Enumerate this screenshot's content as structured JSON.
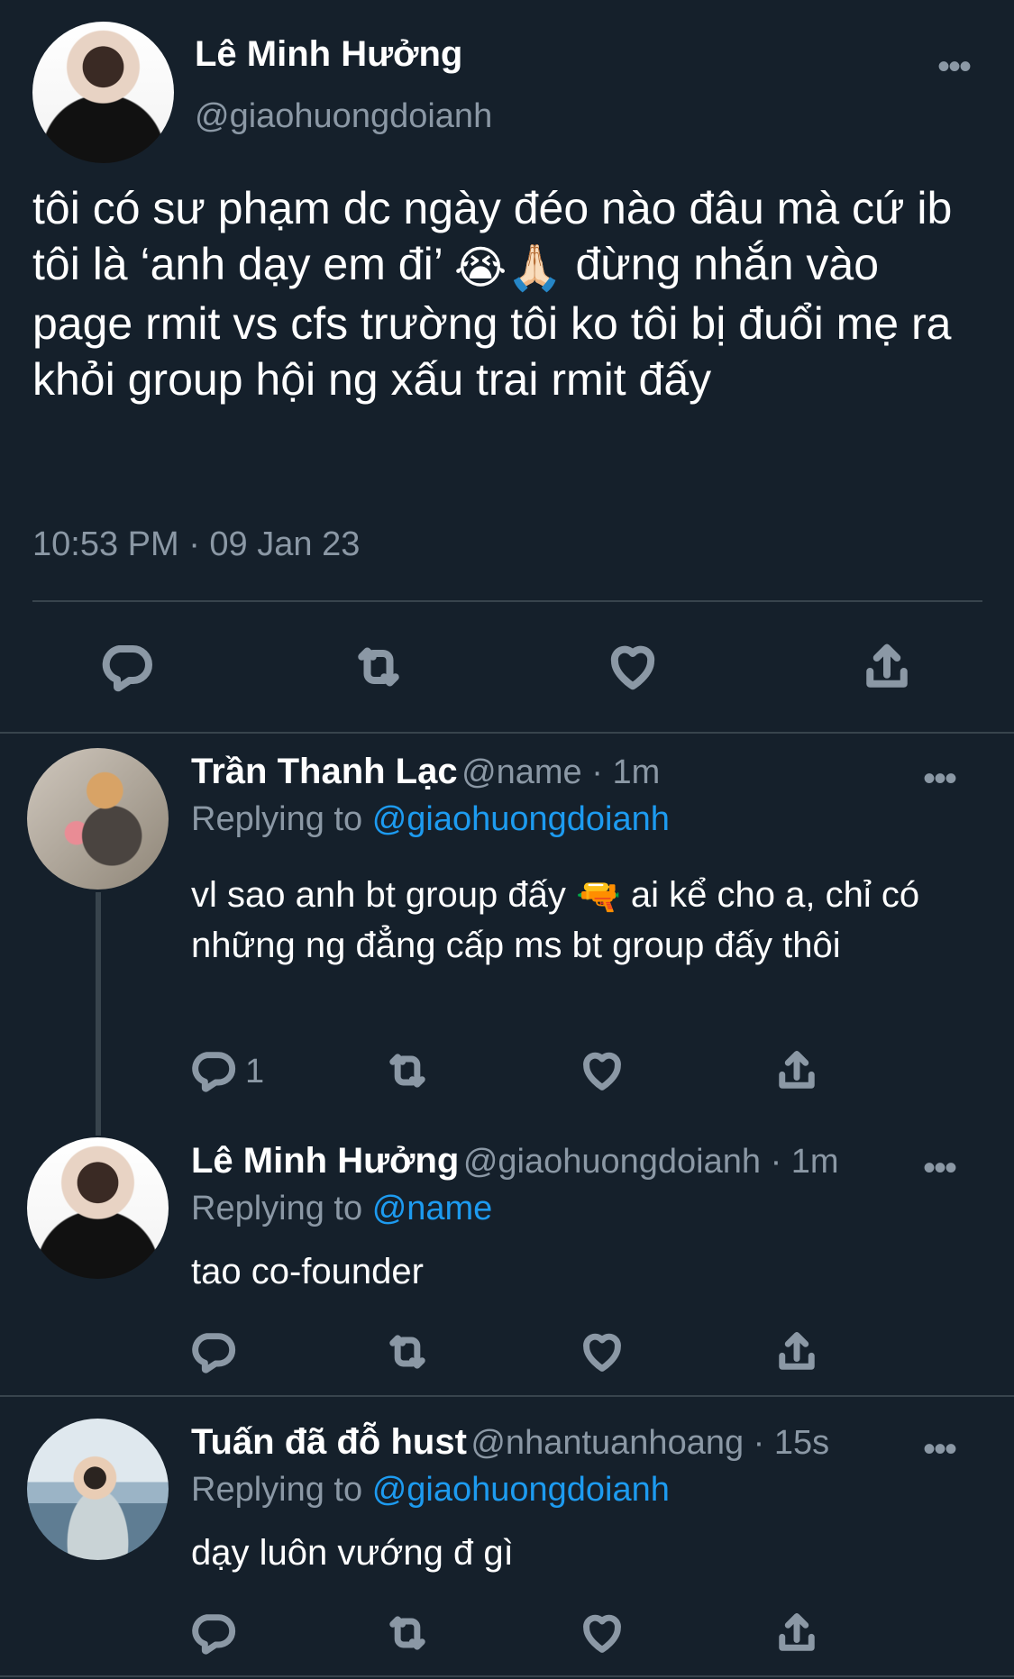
{
  "main_tweet": {
    "author_name": "Lê Minh Hưởng",
    "author_handle": "@giaohuongdoianh",
    "text_part1": "tôi có sư phạm dc ngày đéo nào đâu mà cứ ib tôi là ‘anh dạy em đi’",
    "emoji1": "😭",
    "emoji2": "🙏🏻",
    "text_part2": "đừng nhắn vào page rmit vs cfs trường tôi ko tôi bị đuổi mẹ ra khỏi group hội ng xấu trai rmit đấy",
    "timestamp": "10:53 PM · 09 Jan 23",
    "more_label": "•••"
  },
  "replies": [
    {
      "name": "Trần Thanh Lạc",
      "handle_time": "@name · 1m",
      "replying_prefix": "Replying to",
      "replying_to": "@giaohuongdoianh",
      "text_part1": "vl sao anh bt group đấy",
      "emoji": "🔫",
      "text_part2": "ai kể cho a, chỉ có những ng đẳng cấp ms bt group đấy thôi",
      "reply_count": "1",
      "more_label": "•••"
    },
    {
      "name": "Lê Minh Hưởng",
      "handle_time": "@giaohuongdoianh · 1m",
      "replying_prefix": "Replying to",
      "replying_to": "@name",
      "text": "tao co-founder",
      "more_label": "•••"
    },
    {
      "name": "Tuấn đã đỗ hust",
      "handle_time": "@nhantuanhoang · 15s",
      "replying_prefix": "Replying to",
      "replying_to": "@giaohuongdoianh",
      "text": "dạy luôn vướng đ gì",
      "more_label": "•••"
    }
  ],
  "icons": {
    "reply": "reply-icon",
    "retweet": "retweet-icon",
    "like": "heart-icon",
    "share": "share-icon"
  },
  "colors": {
    "background": "#15202b",
    "muted": "#8b98a5",
    "link": "#1d9bf0",
    "divider": "#38444d"
  }
}
